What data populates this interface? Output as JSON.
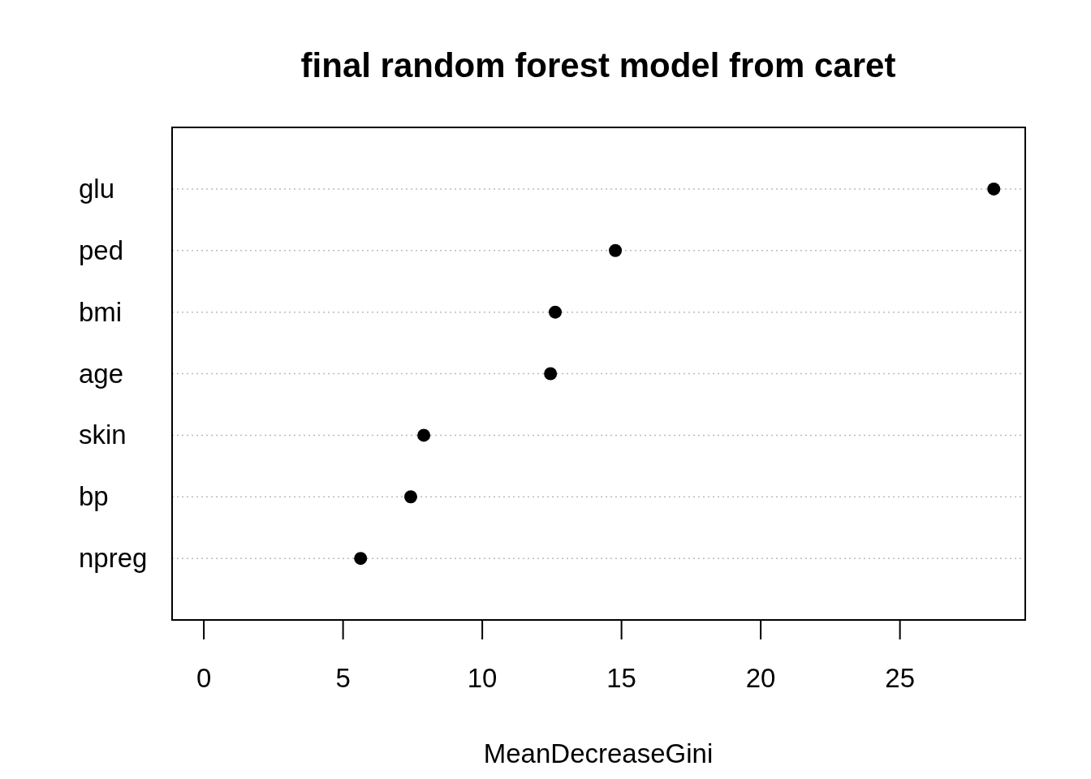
{
  "chart_data": {
    "type": "scatter",
    "orientation": "horizontal",
    "title": "final random forest model from caret",
    "xlabel": "MeanDecreaseGini",
    "categories": [
      "glu",
      "ped",
      "bmi",
      "age",
      "skin",
      "bp",
      "npreg"
    ],
    "values": [
      28.37,
      14.78,
      12.62,
      12.45,
      7.9,
      7.43,
      5.63
    ],
    "xlim": [
      -1.14,
      29.5
    ],
    "xticks": [
      0,
      5,
      10,
      15,
      20,
      25
    ]
  }
}
